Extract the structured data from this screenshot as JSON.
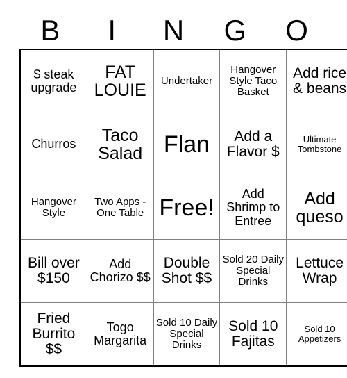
{
  "card": {
    "header_letters": [
      "B",
      "I",
      "N",
      "G",
      "O"
    ],
    "grid": {
      "columns": 5,
      "rows": 5,
      "cells": [
        {
          "text": "$ steak upgrade",
          "size": "fs-m"
        },
        {
          "text": "FAT LOUIE",
          "size": "fs-xl"
        },
        {
          "text": "Undertaker",
          "size": "fs-s"
        },
        {
          "text": "Hangover Style Taco Basket",
          "size": "fs-s"
        },
        {
          "text": "Add rice & beans",
          "size": "fs-l"
        },
        {
          "text": "Churros",
          "size": "fs-m"
        },
        {
          "text": "Taco Salad",
          "size": "fs-xl"
        },
        {
          "text": "Flan",
          "size": "fs-xxl"
        },
        {
          "text": "Add a Flavor $",
          "size": "fs-l"
        },
        {
          "text": "Ultimate Tombstone",
          "size": "fs-xs"
        },
        {
          "text": "Hangover Style",
          "size": "fs-s"
        },
        {
          "text": "Two Apps - One Table",
          "size": "fs-s"
        },
        {
          "text": "Free!",
          "size": "fs-xxl"
        },
        {
          "text": "Add Shrimp to Entree",
          "size": "fs-m"
        },
        {
          "text": "Add queso",
          "size": "fs-xl"
        },
        {
          "text": "Bill over $150",
          "size": "fs-l"
        },
        {
          "text": "Add Chorizo $$",
          "size": "fs-m"
        },
        {
          "text": "Double Shot $$",
          "size": "fs-l"
        },
        {
          "text": "Sold 20 Daily Special Drinks",
          "size": "fs-s"
        },
        {
          "text": "Lettuce Wrap",
          "size": "fs-l"
        },
        {
          "text": "Fried Burrito $$",
          "size": "fs-l"
        },
        {
          "text": "Togo Margarita",
          "size": "fs-m"
        },
        {
          "text": "Sold 10 Daily Special Drinks",
          "size": "fs-s"
        },
        {
          "text": "Sold 10 Fajitas",
          "size": "fs-l"
        },
        {
          "text": "Sold 10 Appetizers",
          "size": "fs-xs"
        }
      ]
    },
    "colors": {
      "background": "#ffffff",
      "text": "#000000",
      "outer_border": "#000000",
      "inner_border": "#808080"
    }
  }
}
